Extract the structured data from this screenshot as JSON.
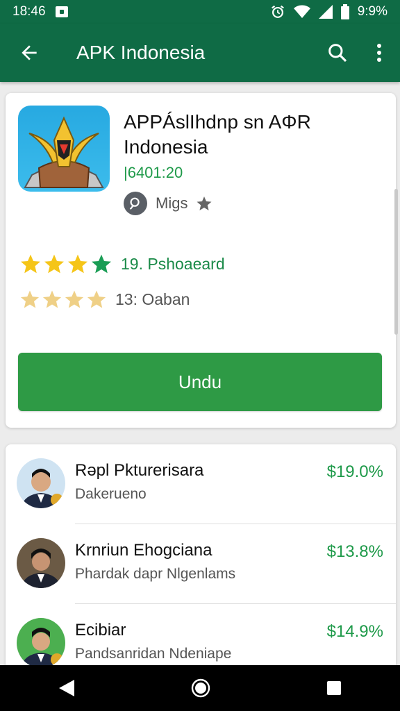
{
  "status_bar": {
    "time": "18:46",
    "battery": "9:9%"
  },
  "app_bar": {
    "title": "APK Indonesia"
  },
  "app_card": {
    "name": "APPÁslIhdnp sn AΦR Indonesia",
    "version": "|6401:20",
    "developer": "Migs",
    "rating_primary": "19. Pshoaeard",
    "rating_secondary": "13: Oaban",
    "download_label": "Undu"
  },
  "list": [
    {
      "name": "Rəpl Pkturerisara",
      "subtitle": "Dakerueno",
      "price": "$19.0%"
    },
    {
      "name": "Krnriun Ehogciana",
      "subtitle": "Phardak dapr Nlgenlams",
      "price": "$13.8%"
    },
    {
      "name": "Ecibiar",
      "subtitle": "Pandsanridan Ndeniape",
      "price": "$14.9%"
    }
  ],
  "colors": {
    "primary": "#0f6b45",
    "accent": "#2e9a45",
    "price": "#1f9a4a",
    "star_gold": "#f5c518",
    "star_green": "#1a9d55"
  }
}
